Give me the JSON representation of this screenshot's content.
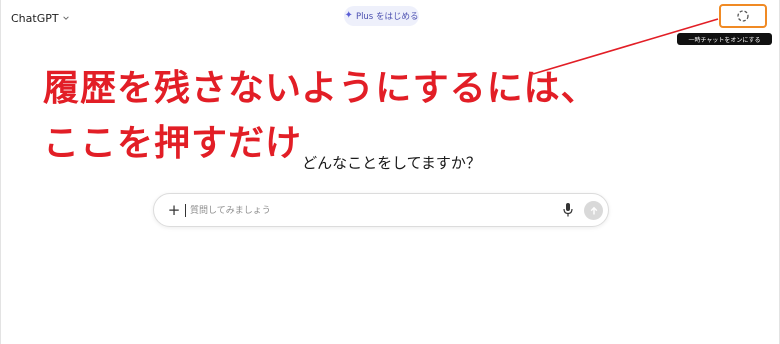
{
  "header": {
    "model_label": "ChatGPT",
    "upgrade_pill": {
      "icon": "sparkle-icon",
      "label": "Plus をはじめる"
    },
    "temporary_chat": {
      "icon": "dashed-circle-icon",
      "tooltip": "一時チャットをオンにする"
    }
  },
  "annotation": {
    "line1": "履歴を残さないようにするには、",
    "line2": "ここを押すだけ",
    "color": "#e21e26",
    "highlight_color": "#f08a24"
  },
  "main": {
    "heading": "どんなことをしてますか？"
  },
  "composer": {
    "placeholder": "質問してみましょう",
    "add_icon": "plus-icon",
    "mic_icon": "microphone-icon",
    "send_icon": "arrow-up-icon"
  }
}
